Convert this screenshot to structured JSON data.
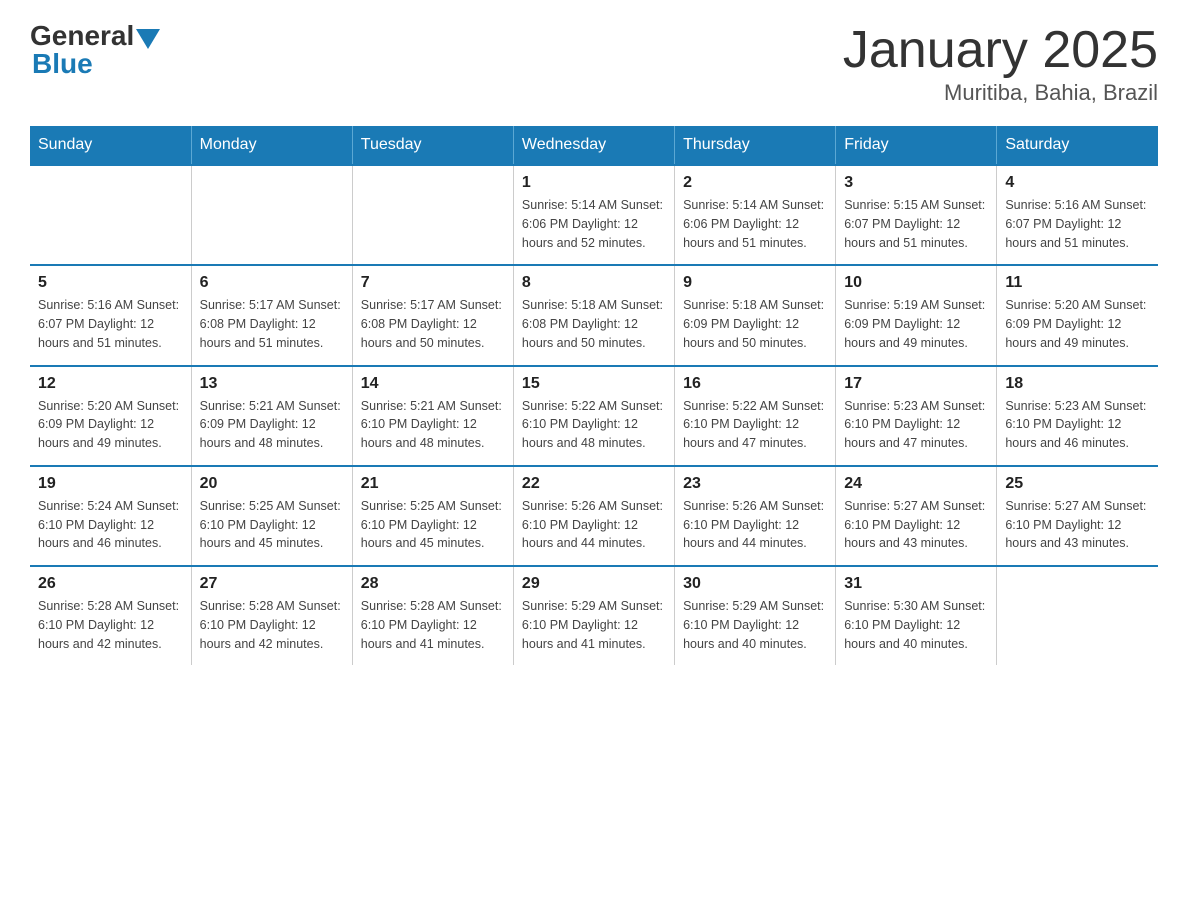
{
  "logo": {
    "general": "General",
    "blue": "Blue"
  },
  "header": {
    "title": "January 2025",
    "location": "Muritiba, Bahia, Brazil"
  },
  "days_of_week": [
    "Sunday",
    "Monday",
    "Tuesday",
    "Wednesday",
    "Thursday",
    "Friday",
    "Saturday"
  ],
  "weeks": [
    [
      {
        "day": "",
        "info": ""
      },
      {
        "day": "",
        "info": ""
      },
      {
        "day": "",
        "info": ""
      },
      {
        "day": "1",
        "info": "Sunrise: 5:14 AM\nSunset: 6:06 PM\nDaylight: 12 hours\nand 52 minutes."
      },
      {
        "day": "2",
        "info": "Sunrise: 5:14 AM\nSunset: 6:06 PM\nDaylight: 12 hours\nand 51 minutes."
      },
      {
        "day": "3",
        "info": "Sunrise: 5:15 AM\nSunset: 6:07 PM\nDaylight: 12 hours\nand 51 minutes."
      },
      {
        "day": "4",
        "info": "Sunrise: 5:16 AM\nSunset: 6:07 PM\nDaylight: 12 hours\nand 51 minutes."
      }
    ],
    [
      {
        "day": "5",
        "info": "Sunrise: 5:16 AM\nSunset: 6:07 PM\nDaylight: 12 hours\nand 51 minutes."
      },
      {
        "day": "6",
        "info": "Sunrise: 5:17 AM\nSunset: 6:08 PM\nDaylight: 12 hours\nand 51 minutes."
      },
      {
        "day": "7",
        "info": "Sunrise: 5:17 AM\nSunset: 6:08 PM\nDaylight: 12 hours\nand 50 minutes."
      },
      {
        "day": "8",
        "info": "Sunrise: 5:18 AM\nSunset: 6:08 PM\nDaylight: 12 hours\nand 50 minutes."
      },
      {
        "day": "9",
        "info": "Sunrise: 5:18 AM\nSunset: 6:09 PM\nDaylight: 12 hours\nand 50 minutes."
      },
      {
        "day": "10",
        "info": "Sunrise: 5:19 AM\nSunset: 6:09 PM\nDaylight: 12 hours\nand 49 minutes."
      },
      {
        "day": "11",
        "info": "Sunrise: 5:20 AM\nSunset: 6:09 PM\nDaylight: 12 hours\nand 49 minutes."
      }
    ],
    [
      {
        "day": "12",
        "info": "Sunrise: 5:20 AM\nSunset: 6:09 PM\nDaylight: 12 hours\nand 49 minutes."
      },
      {
        "day": "13",
        "info": "Sunrise: 5:21 AM\nSunset: 6:09 PM\nDaylight: 12 hours\nand 48 minutes."
      },
      {
        "day": "14",
        "info": "Sunrise: 5:21 AM\nSunset: 6:10 PM\nDaylight: 12 hours\nand 48 minutes."
      },
      {
        "day": "15",
        "info": "Sunrise: 5:22 AM\nSunset: 6:10 PM\nDaylight: 12 hours\nand 48 minutes."
      },
      {
        "day": "16",
        "info": "Sunrise: 5:22 AM\nSunset: 6:10 PM\nDaylight: 12 hours\nand 47 minutes."
      },
      {
        "day": "17",
        "info": "Sunrise: 5:23 AM\nSunset: 6:10 PM\nDaylight: 12 hours\nand 47 minutes."
      },
      {
        "day": "18",
        "info": "Sunrise: 5:23 AM\nSunset: 6:10 PM\nDaylight: 12 hours\nand 46 minutes."
      }
    ],
    [
      {
        "day": "19",
        "info": "Sunrise: 5:24 AM\nSunset: 6:10 PM\nDaylight: 12 hours\nand 46 minutes."
      },
      {
        "day": "20",
        "info": "Sunrise: 5:25 AM\nSunset: 6:10 PM\nDaylight: 12 hours\nand 45 minutes."
      },
      {
        "day": "21",
        "info": "Sunrise: 5:25 AM\nSunset: 6:10 PM\nDaylight: 12 hours\nand 45 minutes."
      },
      {
        "day": "22",
        "info": "Sunrise: 5:26 AM\nSunset: 6:10 PM\nDaylight: 12 hours\nand 44 minutes."
      },
      {
        "day": "23",
        "info": "Sunrise: 5:26 AM\nSunset: 6:10 PM\nDaylight: 12 hours\nand 44 minutes."
      },
      {
        "day": "24",
        "info": "Sunrise: 5:27 AM\nSunset: 6:10 PM\nDaylight: 12 hours\nand 43 minutes."
      },
      {
        "day": "25",
        "info": "Sunrise: 5:27 AM\nSunset: 6:10 PM\nDaylight: 12 hours\nand 43 minutes."
      }
    ],
    [
      {
        "day": "26",
        "info": "Sunrise: 5:28 AM\nSunset: 6:10 PM\nDaylight: 12 hours\nand 42 minutes."
      },
      {
        "day": "27",
        "info": "Sunrise: 5:28 AM\nSunset: 6:10 PM\nDaylight: 12 hours\nand 42 minutes."
      },
      {
        "day": "28",
        "info": "Sunrise: 5:28 AM\nSunset: 6:10 PM\nDaylight: 12 hours\nand 41 minutes."
      },
      {
        "day": "29",
        "info": "Sunrise: 5:29 AM\nSunset: 6:10 PM\nDaylight: 12 hours\nand 41 minutes."
      },
      {
        "day": "30",
        "info": "Sunrise: 5:29 AM\nSunset: 6:10 PM\nDaylight: 12 hours\nand 40 minutes."
      },
      {
        "day": "31",
        "info": "Sunrise: 5:30 AM\nSunset: 6:10 PM\nDaylight: 12 hours\nand 40 minutes."
      },
      {
        "day": "",
        "info": ""
      }
    ]
  ]
}
